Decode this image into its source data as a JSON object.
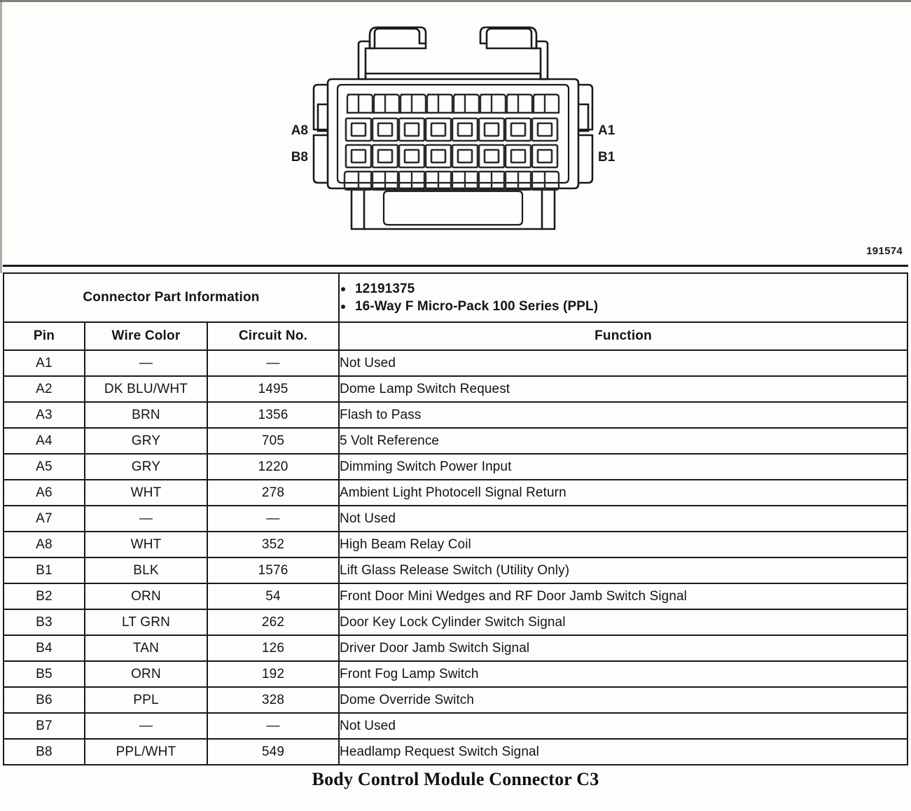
{
  "figure": {
    "number": "191574",
    "caption": "Body Control Module Connector C3",
    "connector": {
      "label_top_left": "A8",
      "label_bottom_left": "B8",
      "label_top_right": "A1",
      "label_bottom_right": "B1",
      "columns": 8,
      "rows": 2
    }
  },
  "table": {
    "part_info_title": "Connector Part Information",
    "part_info_items": [
      "12191375",
      "16-Way F Micro-Pack 100 Series (PPL)"
    ],
    "headers": {
      "pin": "Pin",
      "wire_color": "Wire Color",
      "circuit_no": "Circuit No.",
      "function": "Function"
    },
    "rows": [
      {
        "pin": "A1",
        "wire_color": "—",
        "circuit_no": "—",
        "function": "Not Used"
      },
      {
        "pin": "A2",
        "wire_color": "DK BLU/WHT",
        "circuit_no": "1495",
        "function": "Dome Lamp Switch Request"
      },
      {
        "pin": "A3",
        "wire_color": "BRN",
        "circuit_no": "1356",
        "function": "Flash to Pass"
      },
      {
        "pin": "A4",
        "wire_color": "GRY",
        "circuit_no": "705",
        "function": "5 Volt Reference"
      },
      {
        "pin": "A5",
        "wire_color": "GRY",
        "circuit_no": "1220",
        "function": "Dimming Switch Power Input"
      },
      {
        "pin": "A6",
        "wire_color": "WHT",
        "circuit_no": "278",
        "function": "Ambient Light Photocell Signal Return"
      },
      {
        "pin": "A7",
        "wire_color": "—",
        "circuit_no": "—",
        "function": "Not Used"
      },
      {
        "pin": "A8",
        "wire_color": "WHT",
        "circuit_no": "352",
        "function": "High Beam Relay Coil"
      },
      {
        "pin": "B1",
        "wire_color": "BLK",
        "circuit_no": "1576",
        "function": "Lift Glass Release Switch (Utility Only)"
      },
      {
        "pin": "B2",
        "wire_color": "ORN",
        "circuit_no": "54",
        "function": "Front Door Mini Wedges and RF Door Jamb Switch Signal"
      },
      {
        "pin": "B3",
        "wire_color": "LT GRN",
        "circuit_no": "262",
        "function": "Door Key Lock Cylinder Switch Signal"
      },
      {
        "pin": "B4",
        "wire_color": "TAN",
        "circuit_no": "126",
        "function": "Driver Door Jamb Switch Signal"
      },
      {
        "pin": "B5",
        "wire_color": "ORN",
        "circuit_no": "192",
        "function": "Front Fog Lamp Switch"
      },
      {
        "pin": "B6",
        "wire_color": "PPL",
        "circuit_no": "328",
        "function": "Dome Override Switch"
      },
      {
        "pin": "B7",
        "wire_color": "—",
        "circuit_no": "—",
        "function": "Not Used"
      },
      {
        "pin": "B8",
        "wire_color": "PPL/WHT",
        "circuit_no": "549",
        "function": "Headlamp Request Switch Signal"
      }
    ]
  },
  "colors": {
    "ink": "#1a1a1a",
    "paper": "#fdfdfb"
  }
}
